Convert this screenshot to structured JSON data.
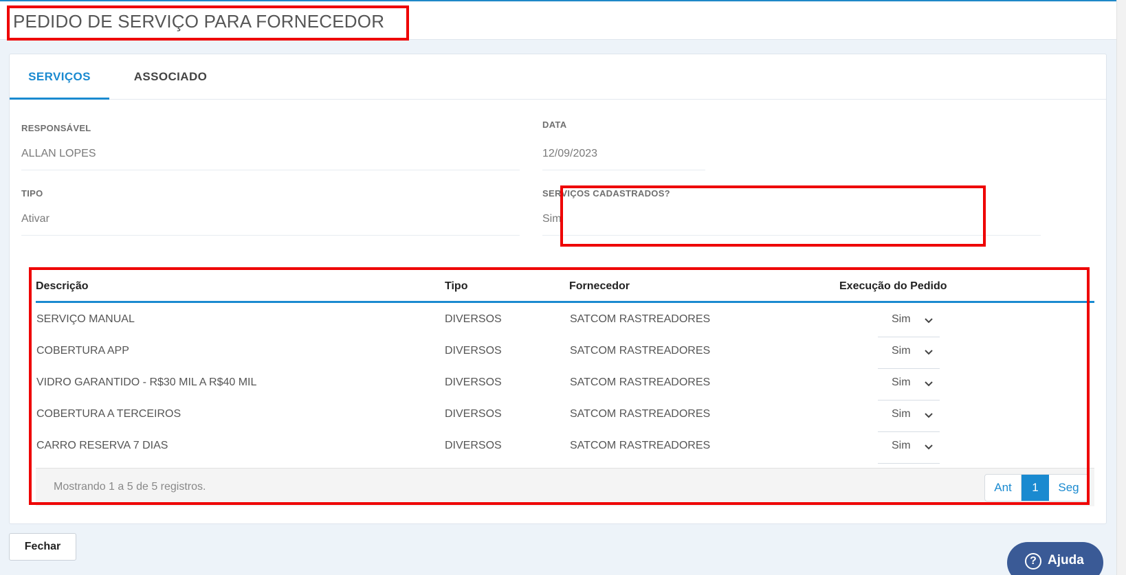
{
  "header": {
    "title": "PEDIDO DE SERVIÇO PARA FORNECEDOR"
  },
  "tabs": [
    {
      "label": "SERVIÇOS",
      "active": true
    },
    {
      "label": "ASSOCIADO",
      "active": false
    }
  ],
  "form": {
    "responsavel": {
      "label": "RESPONSÁVEL",
      "value": "ALLAN LOPES"
    },
    "data": {
      "label": "DATA",
      "value": "12/09/2023"
    },
    "tipo": {
      "label": "TIPO",
      "value": "Ativar"
    },
    "servicos_cadastrados": {
      "label": "SERVIÇOS CADASTRADOS?",
      "value": "Sim"
    }
  },
  "table": {
    "columns": [
      "Descrição",
      "Tipo",
      "Fornecedor",
      "Execução do Pedido"
    ],
    "rows": [
      {
        "descricao": "SERVIÇO MANUAL",
        "tipo": "DIVERSOS",
        "fornecedor": "SATCOM RASTREADORES",
        "execucao": "Sim"
      },
      {
        "descricao": "COBERTURA APP",
        "tipo": "DIVERSOS",
        "fornecedor": "SATCOM RASTREADORES",
        "execucao": "Sim"
      },
      {
        "descricao": "VIDRO GARANTIDO - R$30 MIL A R$40 MIL",
        "tipo": "DIVERSOS",
        "fornecedor": "SATCOM RASTREADORES",
        "execucao": "Sim"
      },
      {
        "descricao": "COBERTURA A TERCEIROS",
        "tipo": "DIVERSOS",
        "fornecedor": "SATCOM RASTREADORES",
        "execucao": "Sim"
      },
      {
        "descricao": "CARRO RESERVA 7 DIAS",
        "tipo": "DIVERSOS",
        "fornecedor": "SATCOM RASTREADORES",
        "execucao": "Sim"
      }
    ],
    "footer_text": "Mostrando 1 a 5 de 5 registros.",
    "pagination": {
      "prev": "Ant",
      "current": "1",
      "next": "Seg"
    }
  },
  "actions": {
    "close_label": "Fechar",
    "help_label": "Ajuda",
    "help_icon": "question-circle-icon"
  },
  "colors": {
    "accent": "#1a8ad0",
    "highlight_box": "#ee0000",
    "help_button": "#3a5a96"
  }
}
